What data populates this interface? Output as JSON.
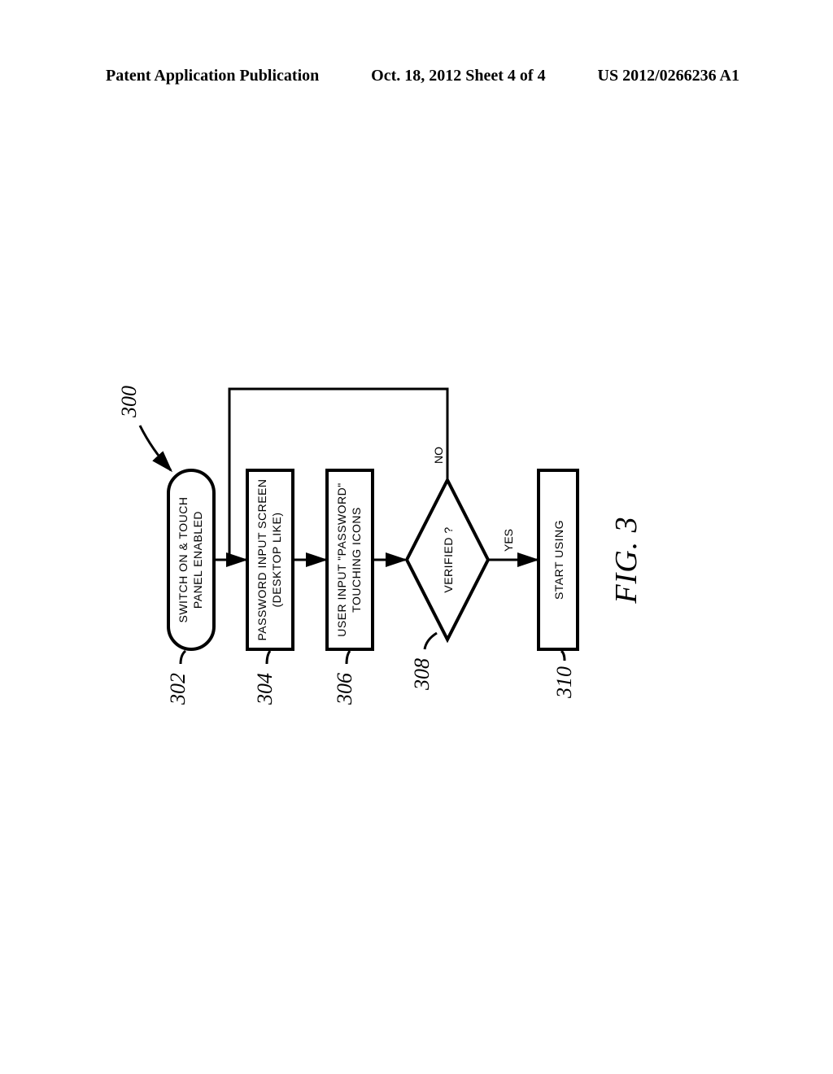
{
  "header": {
    "left": "Patent Application Publication",
    "center": "Oct. 18, 2012  Sheet 4 of 4",
    "right": "US 2012/0266236 A1"
  },
  "flowchart": {
    "ref_main": "300",
    "nodes": {
      "n302": {
        "ref": "302",
        "line1": "SWITCH ON & TOUCH",
        "line2": "PANEL ENABLED"
      },
      "n304": {
        "ref": "304",
        "line1": "PASSWORD INPUT SCREEN",
        "line2": "(DESKTOP LIKE)"
      },
      "n306": {
        "ref": "306",
        "line1": "USER INPUT \"PASSWORD\"",
        "line2": "TOUCHING ICONS"
      },
      "n308": {
        "ref": "308",
        "label": "VERIFIED ?"
      },
      "n310": {
        "ref": "310",
        "label": "START USING"
      }
    },
    "edges": {
      "yes": "YES",
      "no": "NO"
    }
  },
  "figure_label": "FIG. 3"
}
